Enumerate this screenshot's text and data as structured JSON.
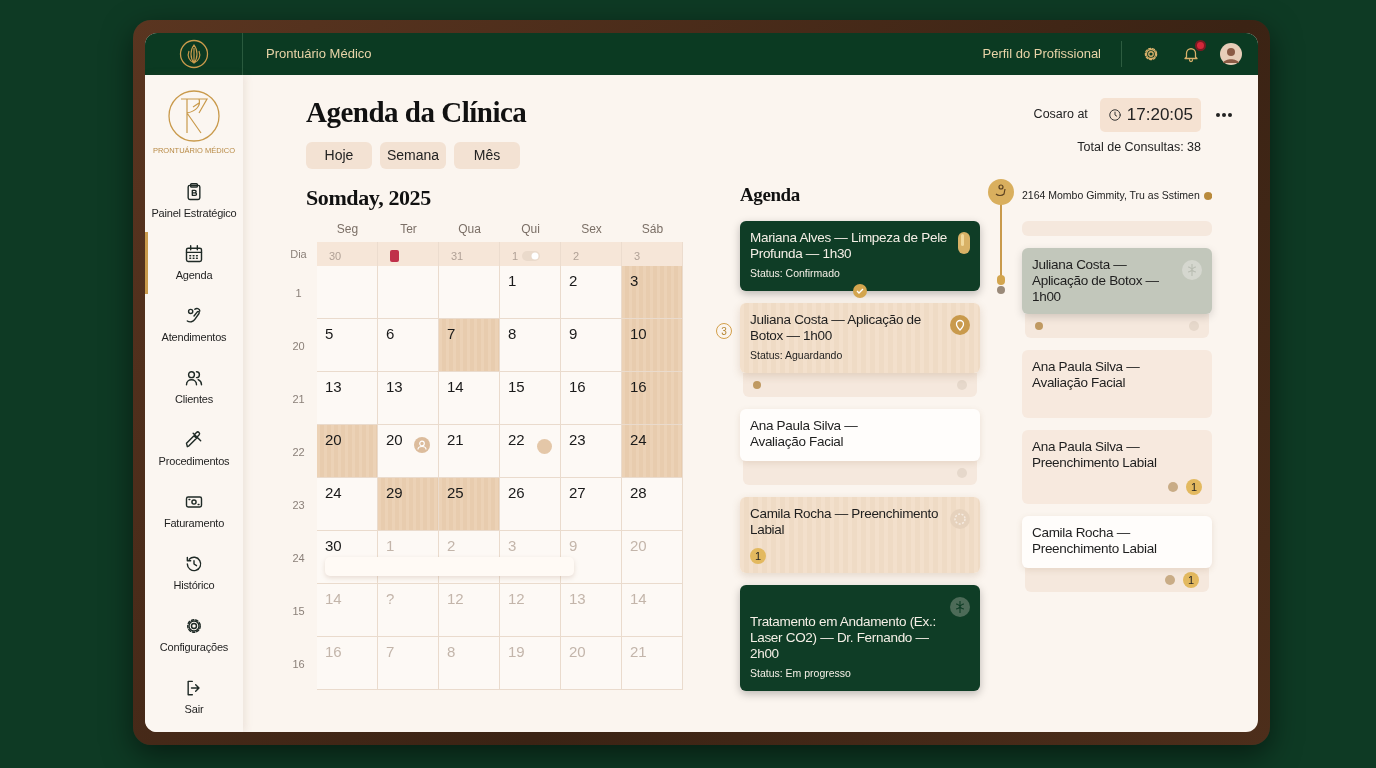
{
  "topbar": {
    "title": "Prontuário Médico",
    "profile_link": "Perfil do Profissional",
    "notifications": true
  },
  "sidebar": {
    "logo_caption": "PRONTUÁRIO MÉDICO",
    "items": [
      {
        "label": "Painel Estratégico",
        "selected": false
      },
      {
        "label": "Agenda",
        "selected": true
      },
      {
        "label": "Atendimentos",
        "selected": false
      },
      {
        "label": "Clientes",
        "selected": false
      },
      {
        "label": "Procedimentos",
        "selected": false
      },
      {
        "label": "Faturamento",
        "selected": false
      },
      {
        "label": "Histórico",
        "selected": false
      },
      {
        "label": "Configurações",
        "selected": false
      },
      {
        "label": "Sair",
        "selected": false
      }
    ]
  },
  "header": {
    "title": "Agenda da Clínica",
    "clock_label": "Cosaro at",
    "time": "17:20:05",
    "total": "Total de Consultas: 38"
  },
  "view_buttons": [
    "Hoje",
    "Semana",
    "Mês"
  ],
  "calendar": {
    "title": "Somday, 2025",
    "corner": "Dia",
    "weekdays": [
      "Seg",
      "Ter",
      "Qua",
      "Qui",
      "Sex",
      "Sáb"
    ],
    "top_row": [
      {
        "kind": "plain",
        "day": "30"
      },
      {
        "kind": "alert"
      },
      {
        "kind": "plain",
        "day": "31"
      },
      {
        "kind": "toggle",
        "day": "1"
      },
      {
        "kind": "plain",
        "day": "2"
      },
      {
        "kind": "plain",
        "day": "3"
      }
    ],
    "rows": [
      {
        "label": "1",
        "cells": [
          {
            "kind": "plain",
            "highlight": false
          },
          {
            "kind": "plain",
            "highlight": false
          },
          {
            "kind": "plain",
            "highlight": false
          },
          {
            "kind": "plain",
            "day": "1",
            "highlight": false,
            "muted": false
          },
          {
            "kind": "plain",
            "day": "2",
            "highlight": false,
            "muted": false
          },
          {
            "kind": "plain",
            "day": "3",
            "highlight": true,
            "muted": false
          }
        ]
      },
      {
        "label": "20",
        "cells": [
          {
            "kind": "plain",
            "day": "5",
            "highlight": false,
            "muted": false
          },
          {
            "kind": "plain",
            "day": "6",
            "highlight": false,
            "muted": false
          },
          {
            "kind": "plain",
            "day": "7",
            "highlight": true,
            "muted": false
          },
          {
            "kind": "plain",
            "day": "8",
            "highlight": false,
            "muted": false
          },
          {
            "kind": "plain",
            "day": "9",
            "highlight": false,
            "muted": false
          },
          {
            "kind": "plain",
            "day": "10",
            "highlight": true,
            "muted": false
          }
        ]
      },
      {
        "label": "21",
        "cells": [
          {
            "kind": "plain",
            "day": "13",
            "highlight": false,
            "muted": false
          },
          {
            "kind": "plain",
            "day": "13",
            "highlight": false,
            "muted": false
          },
          {
            "kind": "plain",
            "day": "14",
            "highlight": false,
            "muted": false
          },
          {
            "kind": "plain",
            "day": "15",
            "highlight": false,
            "muted": false
          },
          {
            "kind": "plain",
            "day": "16",
            "highlight": false,
            "muted": false
          },
          {
            "kind": "plain",
            "day": "16",
            "highlight": true,
            "muted": false
          }
        ]
      },
      {
        "label": "22",
        "cells": [
          {
            "kind": "plain",
            "day": "20",
            "highlight": true,
            "muted": false
          },
          {
            "kind": "person",
            "day": "20",
            "highlight": false,
            "muted": false
          },
          {
            "kind": "plain",
            "day": "21",
            "highlight": false,
            "muted": false
          },
          {
            "kind": "dot",
            "day": "22",
            "highlight": false,
            "muted": false
          },
          {
            "kind": "plain",
            "day": "23",
            "highlight": false,
            "muted": false
          },
          {
            "kind": "plain",
            "day": "24",
            "highlight": true,
            "muted": false
          }
        ]
      },
      {
        "label": "23",
        "cells": [
          {
            "kind": "plain",
            "day": "24",
            "highlight": false,
            "muted": false
          },
          {
            "kind": "plain",
            "day": "29",
            "highlight": true,
            "muted": false
          },
          {
            "kind": "plain",
            "day": "25",
            "highlight": true,
            "muted": false
          },
          {
            "kind": "plain",
            "day": "26",
            "highlight": false,
            "muted": false
          },
          {
            "kind": "plain",
            "day": "27",
            "highlight": false,
            "muted": false
          },
          {
            "kind": "plain",
            "day": "28",
            "highlight": false,
            "muted": false
          }
        ]
      },
      {
        "label": "24",
        "cells": [
          {
            "kind": "plain",
            "day": "30",
            "highlight": false,
            "muted": false
          },
          {
            "kind": "plain",
            "day": "1",
            "highlight": false,
            "muted": true
          },
          {
            "kind": "plain",
            "day": "2",
            "highlight": false,
            "muted": true
          },
          {
            "kind": "plain",
            "day": "3",
            "highlight": false,
            "muted": true
          },
          {
            "kind": "plain",
            "day": "9",
            "highlight": false,
            "muted": true
          },
          {
            "kind": "plain",
            "day": "20",
            "highlight": false,
            "muted": true
          }
        ]
      },
      {
        "label": "15",
        "cells": [
          {
            "kind": "plain",
            "day": "14",
            "highlight": false,
            "muted": true
          },
          {
            "kind": "plain",
            "day": "?",
            "highlight": false,
            "muted": true
          },
          {
            "kind": "plain",
            "day": "12",
            "highlight": false,
            "muted": true
          },
          {
            "kind": "plain",
            "day": "12",
            "highlight": false,
            "muted": true
          },
          {
            "kind": "plain",
            "day": "13",
            "highlight": false,
            "muted": true
          },
          {
            "kind": "plain",
            "day": "14",
            "highlight": false,
            "muted": true
          }
        ]
      },
      {
        "label": "16",
        "cells": [
          {
            "kind": "plain",
            "day": "16",
            "highlight": false,
            "muted": true
          },
          {
            "kind": "plain",
            "day": "7",
            "highlight": false,
            "muted": true
          },
          {
            "kind": "plain",
            "day": "8",
            "highlight": false,
            "muted": true
          },
          {
            "kind": "plain",
            "day": "19",
            "highlight": false,
            "muted": true
          },
          {
            "kind": "plain",
            "day": "20",
            "highlight": false,
            "muted": true
          },
          {
            "kind": "plain",
            "day": "21",
            "highlight": false,
            "muted": true
          }
        ]
      }
    ]
  },
  "agenda": {
    "title": "Agenda",
    "address": "2164 Mombo Gimmity, Tru as Sstimen",
    "left": [
      {
        "kind": "dark",
        "title": "Mariana Alves — Limpeza de Pele Profunda — 1h30",
        "status": "Status: Confirmado",
        "check": true
      },
      {
        "kind": "wood",
        "title": "Juliana Costa — Aplicação de Botox — 1h00",
        "status": "Status: Aguardando",
        "side_number": "3",
        "tray": {
          "left_dot": true,
          "right_dot": true
        }
      },
      {
        "kind": "white",
        "title": "Ana Paula Silva — Avaliação Facial",
        "tray": {
          "right_dot": true
        }
      },
      {
        "kind": "wood",
        "title": "Camila Rocha — Preenchimento Labial",
        "count": "1"
      },
      {
        "kind": "dark",
        "title": "Tratamento em Andamento (Ex.: Laser CO2) — Dr. Fernando — 2h00",
        "status": "Status: Em progresso"
      }
    ],
    "right": [
      {
        "kind": "blank"
      },
      {
        "kind": "gray",
        "title": "Juliana Costa — Aplicação de Botox — 1h00",
        "tray": {
          "left_dot": true,
          "right_dot": true
        }
      },
      {
        "kind": "cream",
        "title": "Ana Paula Silva — Avaliação Facial"
      },
      {
        "kind": "cream",
        "title": "Ana Paula Silva — Preenchimento Labial",
        "count": "1"
      },
      {
        "kind": "white",
        "title": "Camila Rocha — Preenchimento Labial",
        "tray": {
          "right_dot": true,
          "count": "1"
        }
      }
    ]
  }
}
